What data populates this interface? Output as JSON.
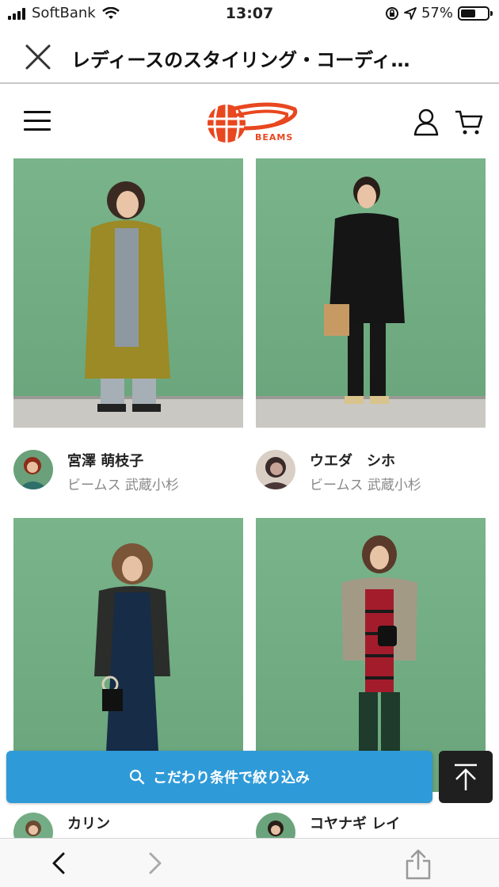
{
  "status_bar": {
    "carrier": "SoftBank",
    "time": "13:07",
    "battery": "57%",
    "battery_level": 0.57
  },
  "browser": {
    "title": "レディースのスタイリング・コーディ…"
  },
  "site": {
    "logo_text": "BEAMS"
  },
  "cards": [
    {
      "name": "宮澤 萌枝子",
      "shop": "ビームス 武蔵小杉"
    },
    {
      "name": "ウエダ　シホ",
      "shop": "ビームス 武蔵小杉"
    },
    {
      "name": "カリン",
      "shop": ""
    },
    {
      "name": "コヤナギ レイ",
      "shop": ""
    }
  ],
  "filter": {
    "label": "こだわり条件で絞り込み"
  },
  "colors": {
    "accent": "#2f9ad8",
    "brand": "#e8471f",
    "wall": "#73ae84"
  }
}
